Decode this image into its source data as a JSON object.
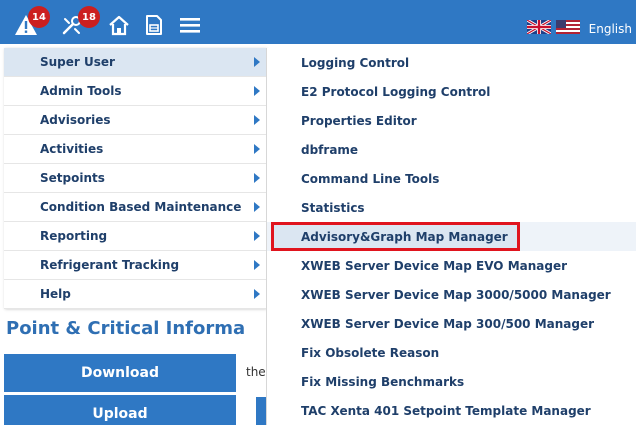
{
  "topbar": {
    "alerts_badge": "14",
    "tools_badge": "18",
    "language_label": "English"
  },
  "main_menu": {
    "items": [
      {
        "label": "Super User"
      },
      {
        "label": "Admin Tools"
      },
      {
        "label": "Advisories"
      },
      {
        "label": "Activities"
      },
      {
        "label": "Setpoints"
      },
      {
        "label": "Condition Based Maintenance"
      },
      {
        "label": "Reporting"
      },
      {
        "label": "Refrigerant Tracking"
      },
      {
        "label": "Help"
      }
    ]
  },
  "submenu": {
    "items": [
      {
        "label": "Logging Control"
      },
      {
        "label": "E2 Protocol Logging Control"
      },
      {
        "label": "Properties Editor"
      },
      {
        "label": "dbframe"
      },
      {
        "label": "Command Line Tools"
      },
      {
        "label": "Statistics"
      },
      {
        "label": "Advisory&Graph Map Manager"
      },
      {
        "label": "XWEB Server Device Map EVO Manager"
      },
      {
        "label": "XWEB Server Device Map 3000/5000 Manager"
      },
      {
        "label": "XWEB Server Device Map 300/500 Manager"
      },
      {
        "label": "Fix Obsolete Reason"
      },
      {
        "label": "Fix Missing Benchmarks"
      },
      {
        "label": "TAC Xenta 401 Setpoint Template Manager"
      }
    ]
  },
  "page": {
    "title": "Point & Critical Informa",
    "download_label": "Download",
    "upload_label": "Upload",
    "body_text_fragment": "the"
  },
  "colors": {
    "accent": "#2f78c4",
    "badge": "#cc1f1f",
    "highlight_border": "#e0141e"
  }
}
